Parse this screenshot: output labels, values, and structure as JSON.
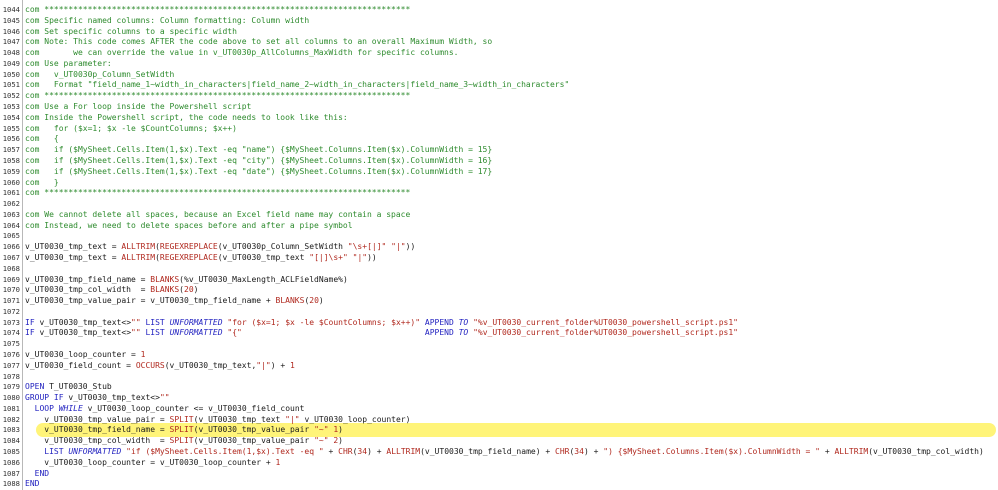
{
  "editor": {
    "lines": [
      {
        "n": "1044",
        "t": "com ****************************************************************************"
      },
      {
        "n": "1045",
        "t": "com Specific named columns: Column formatting: Column width"
      },
      {
        "n": "1046",
        "t": "com Set specific columns to a specific width"
      },
      {
        "n": "1047",
        "t": "com Note: This code comes AFTER the code above to set all columns to an overall Maximum Width, so"
      },
      {
        "n": "1048",
        "t": "com       we can override the value in v_UT0030p_AllColumns_MaxWidth for specific columns."
      },
      {
        "n": "1049",
        "t": "com Use parameter:"
      },
      {
        "n": "1050",
        "t": "com   v_UT0030p_Column_SetWidth"
      },
      {
        "n": "1051",
        "t": "com   Format \"field_name_1~width_in_characters|field_name_2~width_in_characters|field_name_3~width_in_characters\""
      },
      {
        "n": "1052",
        "t": "com ****************************************************************************"
      },
      {
        "n": "1053",
        "t": "com Use a For loop inside the Powershell script"
      },
      {
        "n": "1054",
        "t": "com Inside the Powershell script, the code needs to look like this:"
      },
      {
        "n": "1055",
        "t": "com   for ($x=1; $x -le $CountColumns; $x++)"
      },
      {
        "n": "1056",
        "t": "com   {"
      },
      {
        "n": "1057",
        "t": "com   if ($MySheet.Cells.Item(1,$x).Text -eq \"name\") {$MySheet.Columns.Item($x).ColumnWidth = 15}"
      },
      {
        "n": "1058",
        "t": "com   if ($MySheet.Cells.Item(1,$x).Text -eq \"city\") {$MySheet.Columns.Item($x).ColumnWidth = 16}"
      },
      {
        "n": "1059",
        "t": "com   if ($MySheet.Cells.Item(1,$x).Text -eq \"date\") {$MySheet.Columns.Item($x).ColumnWidth = 17}"
      },
      {
        "n": "1060",
        "t": "com   }"
      },
      {
        "n": "1061",
        "t": "com ****************************************************************************"
      },
      {
        "n": "1062",
        "t": ""
      },
      {
        "n": "1063",
        "t": "com We cannot delete all spaces, because an Excel field name may contain a space"
      },
      {
        "n": "1064",
        "t": "com Instead, we need to delete spaces before and after a pipe symbol"
      },
      {
        "n": "1065",
        "t": ""
      },
      {
        "n": "1066",
        "t": "v_UT0030_tmp_text = ALLTRIM(REGEXREPLACE(v_UT0030p_Column_SetWidth \"\\s+[|]\" \"|\"))"
      },
      {
        "n": "1067",
        "t": "v_UT0030_tmp_text = ALLTRIM(REGEXREPLACE(v_UT0030_tmp_text \"[|]\\s+\" \"|\"))"
      },
      {
        "n": "1068",
        "t": ""
      },
      {
        "n": "1069",
        "t": "v_UT0030_tmp_field_name = BLANKS(%v_UT0030_MaxLength_ACLFieldName%)"
      },
      {
        "n": "1070",
        "t": "v_UT0030_tmp_col_width  = BLANKS(20)"
      },
      {
        "n": "1071",
        "t": "v_UT0030_tmp_value_pair = v_UT0030_tmp_field_name + BLANKS(20)"
      },
      {
        "n": "1072",
        "t": ""
      },
      {
        "n": "1073",
        "t": "IF v_UT0030_tmp_text<>\"\" LIST UNFORMATTED \"for ($x=1; $x -le $CountColumns; $x++)\" APPEND TO \"%v_UT0030_current_folder%UT0030_powershell_script.ps1\""
      },
      {
        "n": "1074",
        "t": "IF v_UT0030_tmp_text<>\"\" LIST UNFORMATTED \"{\"                                      APPEND TO \"%v_UT0030_current_folder%UT0030_powershell_script.ps1\""
      },
      {
        "n": "1075",
        "t": ""
      },
      {
        "n": "1076",
        "t": "v_UT0030_loop_counter = 1"
      },
      {
        "n": "1077",
        "t": "v_UT0030_field_count = OCCURS(v_UT0030_tmp_text,\"|\") + 1"
      },
      {
        "n": "1078",
        "t": ""
      },
      {
        "n": "1079",
        "t": "OPEN T_UT0030_Stub"
      },
      {
        "n": "1080",
        "t": "GROUP IF v_UT0030_tmp_text<>\"\""
      },
      {
        "n": "1081",
        "t": "  LOOP WHILE v_UT0030_loop_counter <= v_UT0030_field_count"
      },
      {
        "n": "1082",
        "t": "    v_UT0030_tmp_value_pair = SPLIT(v_UT0030_tmp_text \"|\" v_UT0030_loop_counter)"
      },
      {
        "n": "1083",
        "t": "    v_UT0030_tmp_field_name = SPLIT(v_UT0030_tmp_value_pair \"~\" 1)"
      },
      {
        "n": "1084",
        "t": "    v_UT0030_tmp_col_width  = SPLIT(v_UT0030_tmp_value_pair \"~\" 2)"
      },
      {
        "n": "1085",
        "t": "    LIST UNFORMATTED \"if ($MySheet.Cells.Item(1,$x).Text -eq \" + CHR(34) + ALLTRIM(v_UT0030_tmp_field_name) + CHR(34) + \") {$MySheet.Columns.Item($x).ColumnWidth = \" + ALLTRIM(v_UT0030_tmp_col_width)"
      },
      {
        "n": "1086",
        "t": "    v_UT0030_loop_counter = v_UT0030_loop_counter + 1"
      },
      {
        "n": "1087",
        "t": "  END"
      },
      {
        "n": "1088",
        "t": "END"
      },
      {
        "n": "1089",
        "t": ""
      },
      {
        "n": "1090",
        "t": "IF v_UT0030_tmp_text<>\"\" LIST UNFORMATTED \"}\" APPEND TO \"%v_UT0030_current_folder%UT0030_powershell_script.ps1\""
      }
    ]
  },
  "colors": {
    "comment": "#2e8b2e",
    "keyword": "#1f1fbf",
    "string": "#b0281e",
    "function": "#b0281e",
    "number": "#b0281e",
    "highlight": "#fff36a"
  }
}
